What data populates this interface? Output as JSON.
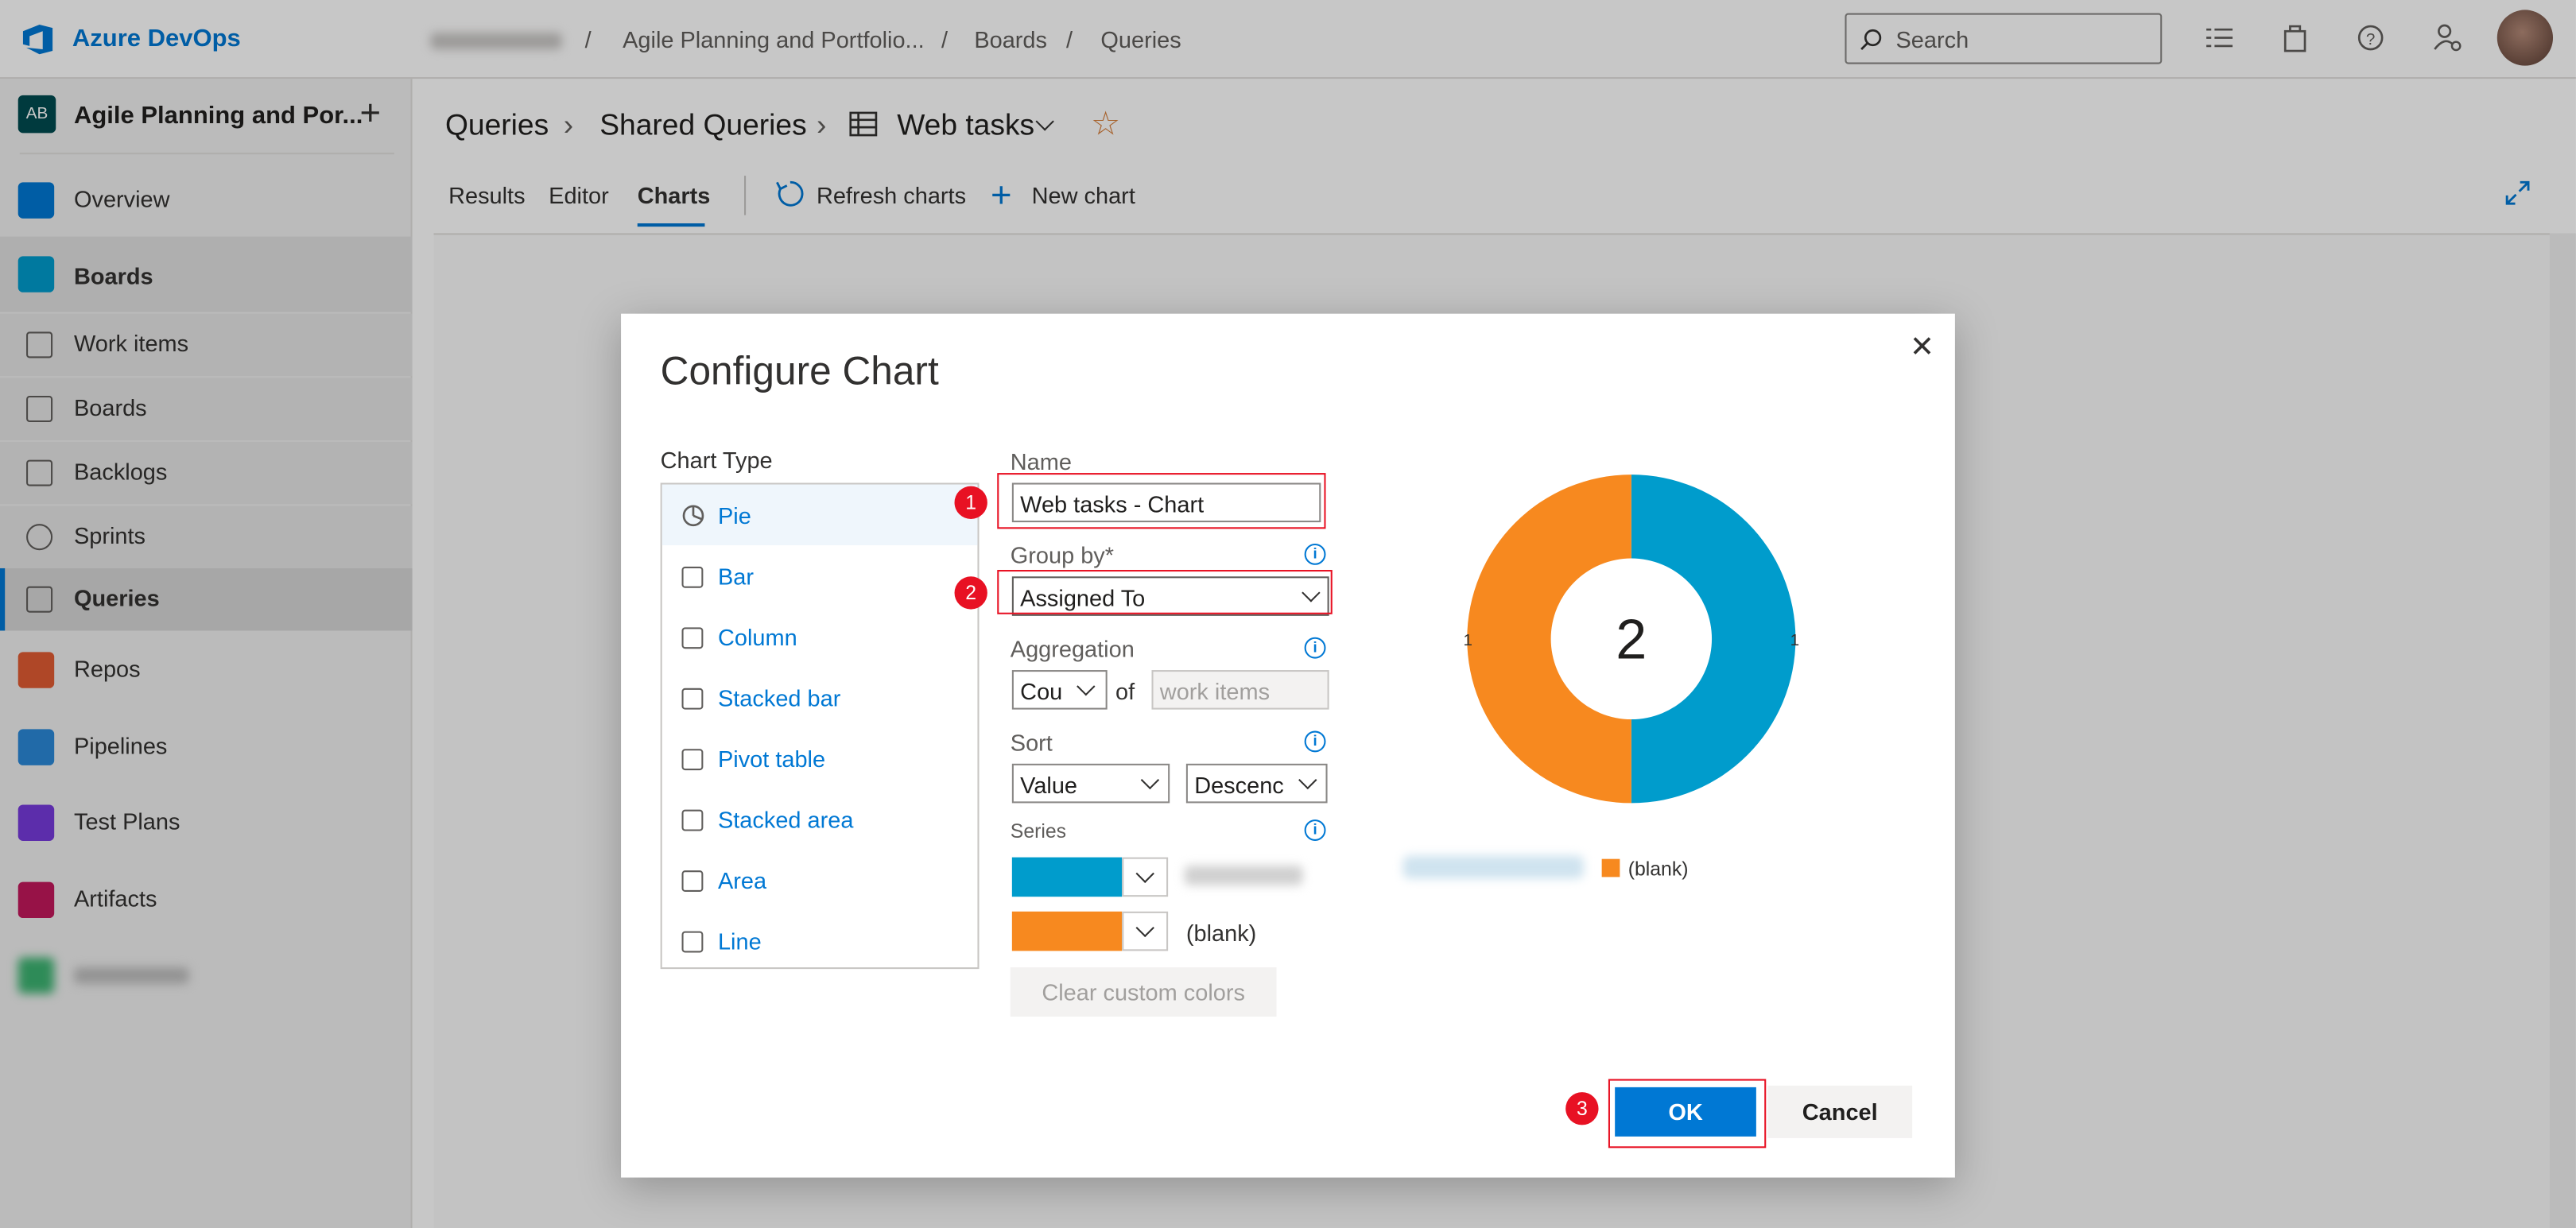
{
  "header": {
    "brand": "Azure DevOps",
    "breadcrumbs": [
      "",
      "Agile Planning and Portfolio...",
      "Boards",
      "Queries"
    ],
    "separators": [
      "/",
      "/",
      "/"
    ],
    "search_placeholder": "Search"
  },
  "sidebar": {
    "project_initials": "AB",
    "project_name": "Agile Planning and Por...",
    "add_label": "+",
    "items": [
      {
        "label": "Overview",
        "icon": "overview-icon",
        "color": "#0078d4"
      },
      {
        "label": "Boards",
        "icon": "boards-icon",
        "color": "#009ccc"
      },
      {
        "label": "Work items",
        "icon": "work-items-icon"
      },
      {
        "label": "Boards",
        "icon": "boards-sub-icon"
      },
      {
        "label": "Backlogs",
        "icon": "backlogs-icon"
      },
      {
        "label": "Sprints",
        "icon": "sprints-icon"
      },
      {
        "label": "Queries",
        "icon": "queries-icon"
      },
      {
        "label": "Repos",
        "icon": "repos-icon",
        "color": "#e05b33"
      },
      {
        "label": "Pipelines",
        "icon": "pipelines-icon",
        "color": "#2b88d8"
      },
      {
        "label": "Test Plans",
        "icon": "test-plans-icon",
        "color": "#773adc"
      },
      {
        "label": "Artifacts",
        "icon": "artifacts-icon",
        "color": "#c2185b"
      },
      {
        "label": "",
        "icon": "compliance-icon",
        "color": "#3cb371"
      }
    ]
  },
  "page": {
    "crumbs": [
      "Queries",
      "Shared Queries",
      "Web tasks"
    ],
    "tabs": [
      "Results",
      "Editor",
      "Charts"
    ],
    "active_tab": "Charts",
    "refresh_label": "Refresh charts",
    "new_chart_label": "New chart"
  },
  "dialog": {
    "title": "Configure Chart",
    "chart_type_label": "Chart Type",
    "chart_types": [
      "Pie",
      "Bar",
      "Column",
      "Stacked bar",
      "Pivot table",
      "Stacked area",
      "Area",
      "Line"
    ],
    "selected_type": "Pie",
    "name_label": "Name",
    "name_value": "Web tasks - Chart",
    "group_by_label": "Group by*",
    "group_by_value": "Assigned To",
    "aggregation_label": "Aggregation",
    "aggregation_value": "Cou",
    "of_label": "of",
    "aggregation_field": "work items",
    "sort_label": "Sort",
    "sort_value": "Value",
    "sort_order": "Descenc",
    "series_label": "Series",
    "series": [
      {
        "name": "",
        "color": "#009ccc"
      },
      {
        "name": "(blank)",
        "color": "#f7891f"
      }
    ],
    "clear_colors_label": "Clear custom colors",
    "ok_label": "OK",
    "cancel_label": "Cancel",
    "markers": [
      "1",
      "2",
      "3"
    ],
    "close_symbol": "✕"
  },
  "chart_data": {
    "type": "pie",
    "categories": [
      "",
      "(blank)"
    ],
    "values": [
      1,
      1
    ],
    "colors": [
      "#009ccc",
      "#f7891f"
    ],
    "total": "2",
    "data_labels": [
      "1",
      "1"
    ],
    "legend": [
      "",
      "(blank)"
    ]
  }
}
